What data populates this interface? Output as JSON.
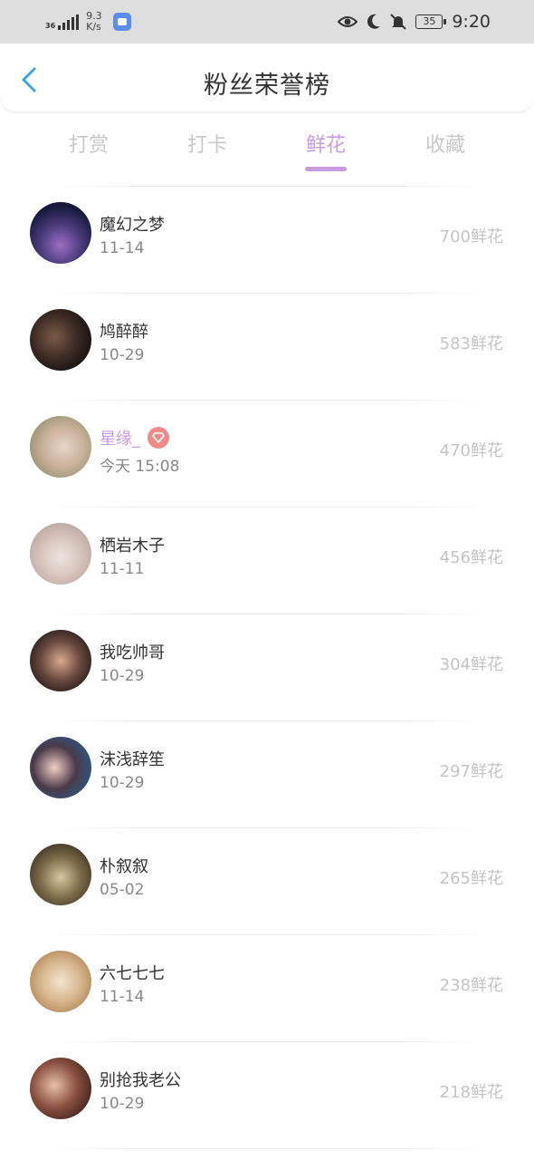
{
  "status_bar": {
    "network": "36",
    "speed_value": "9.3",
    "speed_unit": "K/s",
    "battery": "35",
    "time": "9:20"
  },
  "header": {
    "title": "粉丝荣誉榜"
  },
  "tabs": [
    {
      "label": "打赏",
      "active": false
    },
    {
      "label": "打卡",
      "active": false
    },
    {
      "label": "鲜花",
      "active": true
    },
    {
      "label": "收藏",
      "active": false
    }
  ],
  "rows": [
    {
      "name": "魔幻之梦",
      "date": "11-14",
      "score": "700鲜花"
    },
    {
      "name": "鸠醉醉",
      "date": "10-29",
      "score": "583鲜花"
    },
    {
      "name": "星缘_",
      "date": "今天 15:08",
      "score": "470鲜花"
    },
    {
      "name": "栖岩木子",
      "date": "11-11",
      "score": "456鲜花"
    },
    {
      "name": "我吃帅哥",
      "date": "10-29",
      "score": "304鲜花"
    },
    {
      "name": "沫浅辞笙",
      "date": "10-29",
      "score": "297鲜花"
    },
    {
      "name": "朴叙叙",
      "date": "05-02",
      "score": "265鲜花"
    },
    {
      "name": "六七七七",
      "date": "11-14",
      "score": "238鲜花"
    },
    {
      "name": "别抢我老公",
      "date": "10-29",
      "score": "218鲜花"
    }
  ],
  "colors": {
    "accent": "#c99be0",
    "vip_badge": "#f08a8a",
    "back_arrow": "#3aa6e8"
  }
}
